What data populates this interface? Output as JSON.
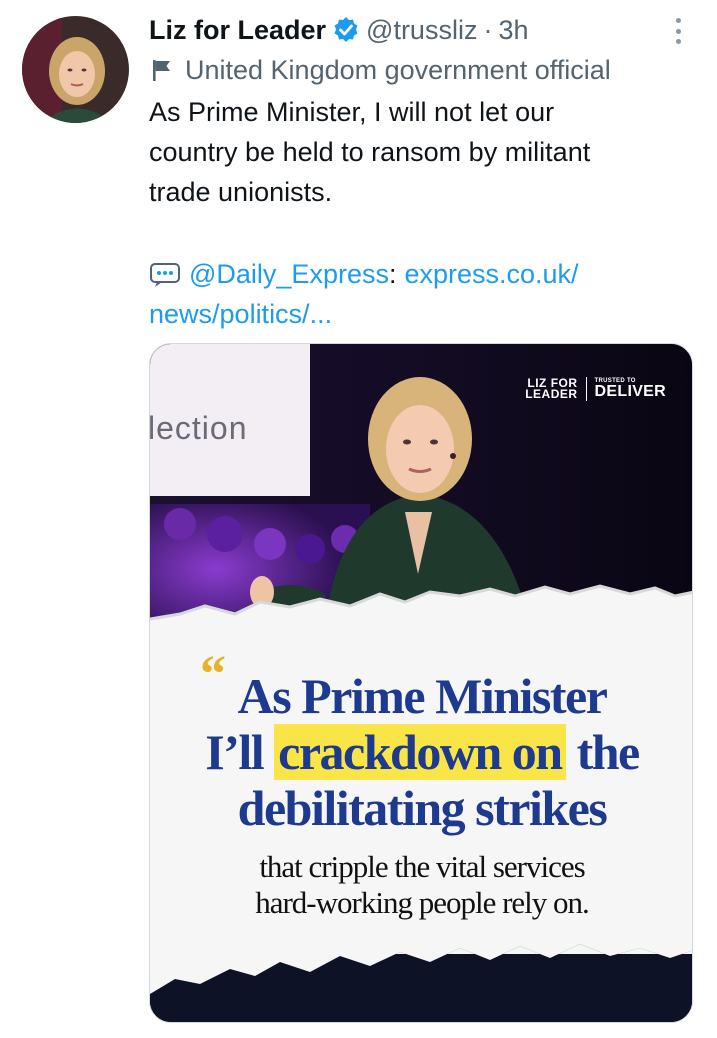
{
  "tweet": {
    "display_name": "Liz for Leader",
    "handle": "@trussliz",
    "separator": "·",
    "time": "3h",
    "label": "United Kingdom government official",
    "text_lines": [
      "As Prime Minister, I will not let our",
      "country be held to ransom by militant",
      "trade unionists."
    ],
    "quote_source": "@Daily_Express",
    "quote_colon": ":",
    "link_line1": "express.co.uk/",
    "link_line2": "news/politics/..."
  },
  "media": {
    "brand_left_top": "LIZ FOR",
    "brand_left_bottom": "LEADER",
    "brand_right_small": "TRUSTED TO",
    "brand_right_big": "DELIVER",
    "screen_text": "lection",
    "quote_mark": "“",
    "headline_line1": "As Prime Minister",
    "headline_line2_pre": "I’ll",
    "headline_line2_highlight": "crackdown on",
    "headline_line2_post": "the",
    "headline_line3": "debilitating strikes",
    "sub_line1": "that cripple the vital services",
    "sub_line2": "hard-working people rely on."
  },
  "colors": {
    "link": "#1d9bf0",
    "verified_badge": "#1d9bf0",
    "headline": "#1d3a8f",
    "highlight": "#f9e547",
    "quote_mark": "#e3b32a"
  },
  "icons": {
    "verified": "verified-badge-icon",
    "label": "flag-icon",
    "quote": "speech-bubble-icon",
    "more": "more-options-icon"
  }
}
